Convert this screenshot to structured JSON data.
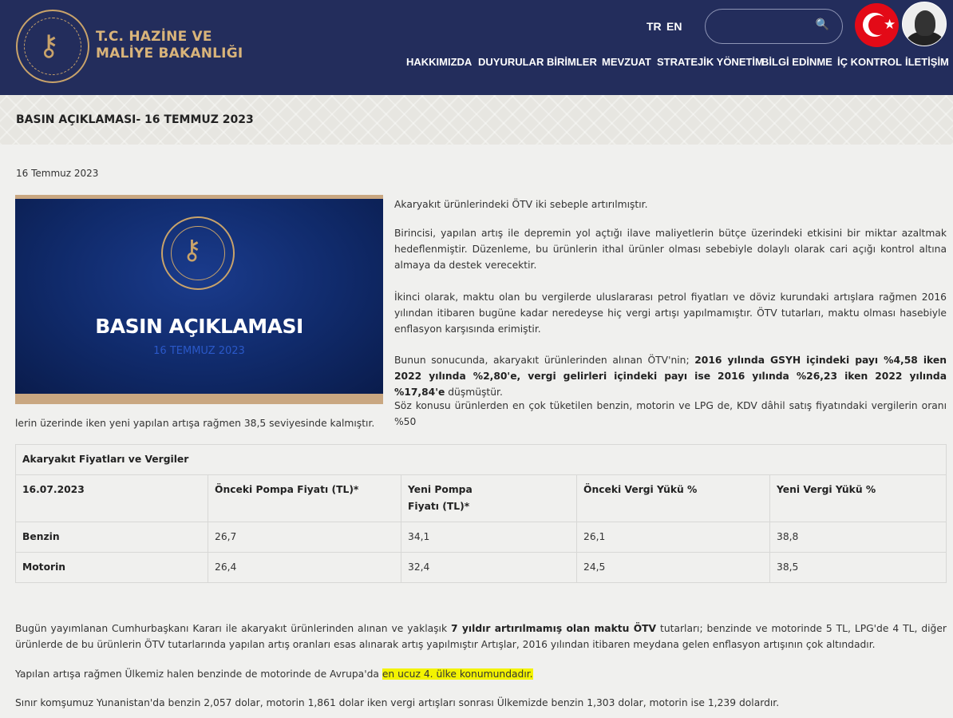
{
  "header": {
    "brand_line1": "T.C. HAZİNE VE",
    "brand_line2": "MALİYE BAKANLIĞI",
    "lang_tr": "TR",
    "lang_en": "EN",
    "search_placeholder": "",
    "nav": [
      "HAKKIMIZDA",
      "DUYURULAR",
      "BİRİMLER",
      "MEVZUAT",
      "STRATEJİK YÖNETİM",
      "BİLGİ EDİNME",
      "İÇ KONTROL",
      "İLETİŞİM"
    ]
  },
  "page": {
    "title": "BASIN AÇIKLAMASI- 16 TEMMUZ 2023",
    "date": "16 Temmuz 2023"
  },
  "press_image": {
    "title": "BASIN AÇIKLAMASI",
    "date": "16 TEMMUZ 2023"
  },
  "content": {
    "p1": "Akaryakıt ürünlerindeki ÖTV iki sebeple artırılmıştır.",
    "p2": "Birincisi, yapılan artış ile depremin yol açtığı ilave maliyetlerin bütçe üzerindeki etkisini bir miktar azaltmak hedeflenmiştir. Düzenleme, bu ürünlerin ithal ürünler olması sebebiyle dolaylı olarak cari açığı kontrol altına almaya da destek verecektir.",
    "p3": "İkinci olarak, maktu olan bu vergilerde uluslararası petrol fiyatları ve döviz kurundaki artışlara rağmen 2016 yılından itibaren bugüne kadar neredeyse hiç vergi artışı yapılmamıştır. ÖTV tutarları, maktu olması hasebiyle enflasyon karşısında erimiştir.",
    "p4_pre": "Bunun sonucunda, akaryakıt ürünlerinden alınan ÖTV'nin; ",
    "p4_bold": "2016 yılında GSYH içindeki payı %4,58 iken 2022 yılında %2,80'e, vergi gelirleri içindeki payı ise 2016 yılında %26,23 iken 2022 yılında %17,84'e",
    "p4_post": " düşmüştür.",
    "p5_line1": "Söz konusu ürünlerden en çok tüketilen benzin, motorin ve LPG de, KDV dâhil satış fiyatındaki vergilerin oranı %50",
    "p5_line2": "lerin üzerinde iken yeni yapılan artışa rağmen 38,5 seviyesinde kalmıştır.",
    "p6_pre": "Bugün yayımlanan Cumhurbaşkanı Kararı ile akaryakıt ürünlerinden alınan ve yaklaşık ",
    "p6_bold": "7 yıldır artırılmamış olan maktu ÖTV",
    "p6_post": " tutarları; benzinde ve motorinde 5 TL, LPG'de 4 TL, diğer ürünlerde de bu ürünlerin ÖTV tutarlarında yapılan artış oranları esas alınarak artış yapılmıştır Artışlar, 2016 yılından itibaren meydana gelen enflasyon artışının çok altındadır.",
    "p7_pre": "Yapılan artışa rağmen Ülkemiz halen benzinde de motorinde de Avrupa'da ",
    "p7_hl": "en ucuz 4. ülke konumundadır.",
    "p8": "Sınır komşumuz Yunanistan'da benzin 2,057 dolar, motorin 1,861 dolar iken vergi artışları sonrası Ülkemizde benzin 1,303 dolar, motorin ise 1,239 dolardır."
  },
  "table": {
    "caption": "Akaryakıt Fiyatları ve Vergiler",
    "headers": [
      "16.07.2023",
      "Önceki Pompa Fiyatı (TL)*",
      "Yeni Pompa Fiyatı (TL)*",
      "Önceki Vergi Yükü %",
      "Yeni Vergi Yükü %"
    ],
    "rows": [
      [
        "Benzin",
        "26,7",
        "34,1",
        "26,1",
        "38,8"
      ],
      [
        "Motorin",
        "26,4",
        "32,4",
        "24,5",
        "38,5"
      ]
    ]
  },
  "colors": {
    "header_bg": "#232d5c",
    "brand_gold": "#d9b47a",
    "highlight": "#f3f300"
  }
}
